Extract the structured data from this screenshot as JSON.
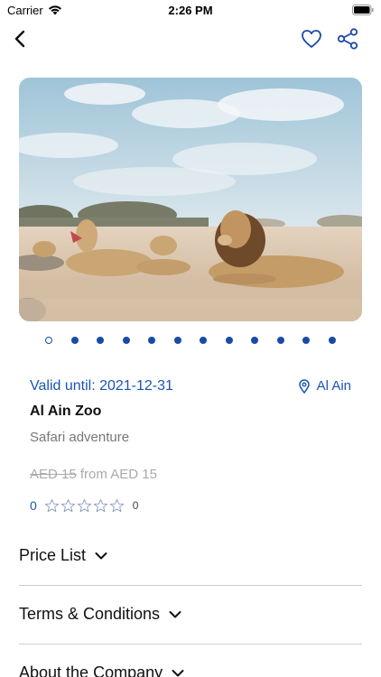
{
  "status_bar": {
    "carrier": "Carrier",
    "time": "2:26 PM"
  },
  "nav": {
    "icons": [
      "back-icon",
      "heart-icon",
      "share-icon"
    ],
    "accent_color": "#1a4aa8"
  },
  "gallery": {
    "image": "lions-in-safari-photo",
    "page_count": 12,
    "active_index": 0
  },
  "offer": {
    "valid_until": "Valid until: 2021-12-31",
    "location": "Al Ain",
    "title": "Al Ain Zoo",
    "subtitle": "Safari adventure",
    "old_price": "AED 15",
    "price": "from AED 15",
    "rating_value": "0",
    "rating_stars_filled": 0,
    "rating_stars_total": 5,
    "rating_count": "0"
  },
  "sections": [
    {
      "label": "Price List"
    },
    {
      "label": "Terms & Conditions"
    },
    {
      "label": "About the Company"
    }
  ]
}
